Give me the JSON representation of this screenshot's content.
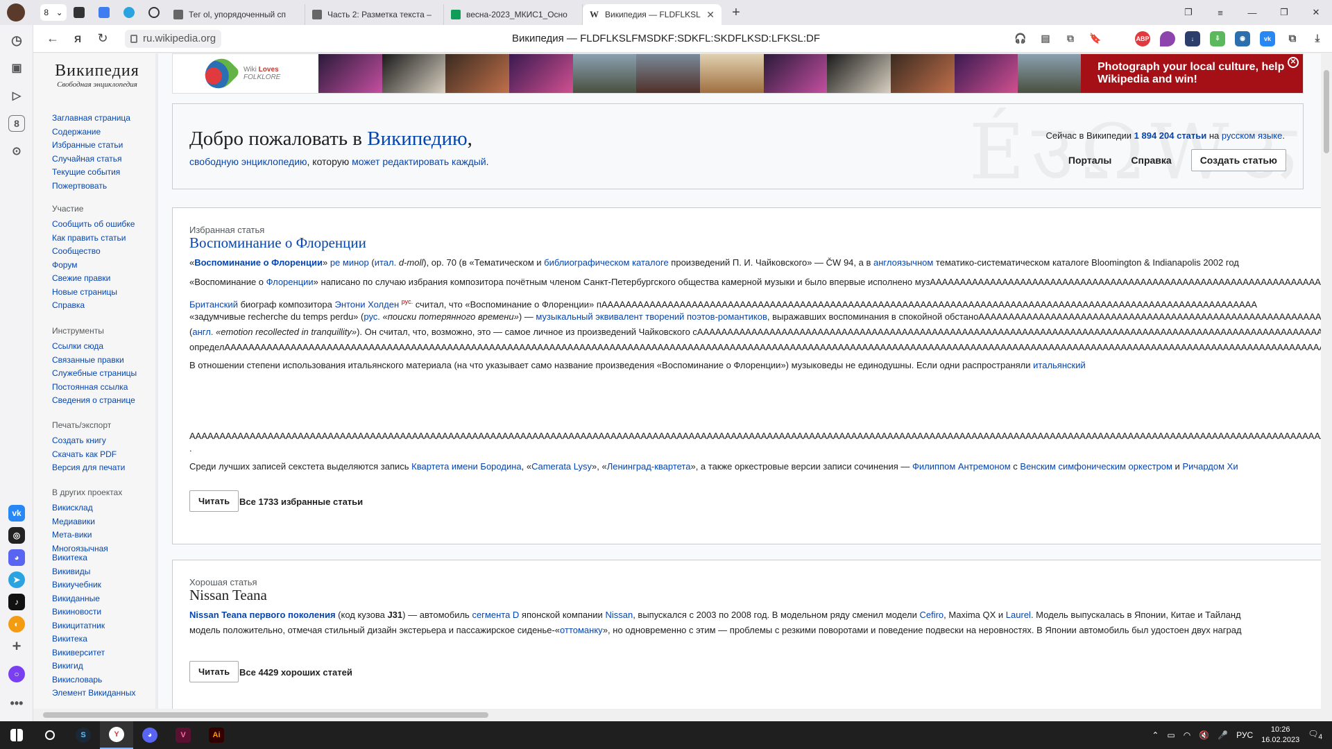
{
  "browser": {
    "tab_count": "8",
    "tabs": [
      {
        "label": "Тег ol, упорядоченный сп",
        "color": "#555"
      },
      {
        "label": "Часть 2: Разметка текста –",
        "color": "#555"
      },
      {
        "label": "весна-2023_МКИС1_Осно",
        "color": "#0f9d58"
      },
      {
        "label": "Википедия — FLDFLKSL",
        "color": "#222"
      }
    ],
    "url": "ru.wikipedia.org",
    "page_title": "Википедия — FLDFLKSLFMSDKF:SDKFL:SKDFLKSD:LFKSL:DF"
  },
  "wiki": {
    "logo_title": "Википедия",
    "logo_subtitle": "Свободная энциклопедия",
    "nav_main": [
      "Заглавная страница",
      "Содержание",
      "Избранные статьи",
      "Случайная статья",
      "Текущие события",
      "Пожертвовать"
    ],
    "nav_participation": {
      "heading": "Участие",
      "items": [
        "Сообщить об ошибке",
        "Как править статьи",
        "Сообщество",
        "Форум",
        "Свежие правки",
        "Новые страницы",
        "Справка"
      ]
    },
    "nav_tools": {
      "heading": "Инструменты",
      "items": [
        "Ссылки сюда",
        "Связанные правки",
        "Служебные страницы",
        "Постоянная ссылка",
        "Сведения о странице"
      ]
    },
    "nav_print": {
      "heading": "Печать/экспорт",
      "items": [
        "Создать книгу",
        "Скачать как PDF",
        "Версия для печати"
      ]
    },
    "nav_projects": {
      "heading": "В других проектах",
      "items": [
        "Викисклад",
        "Медиавики",
        "Мета-вики",
        "Многоязычная Викитека",
        "Викивиды",
        "Викиучебник",
        "Викиданные",
        "Викиновости",
        "Викицитатник",
        "Викитека",
        "Викиверситет",
        "Викигид",
        "Викисловарь",
        "Элемент Викиданных"
      ]
    }
  },
  "banner": {
    "wlf_line1": "Wiki",
    "wlf_bold": "Loves",
    "wlf_line2": "FOLKLORE",
    "cta": "Photograph your local culture, help Wikipedia and win!"
  },
  "welcome": {
    "title_prefix": "Добро пожаловать в ",
    "title_link": "Википедию",
    "title_suffix": ",",
    "sub_link1": "свободную энциклопедию",
    "sub_middle": ", которую ",
    "sub_link2": "может редактировать каждый",
    "sub_end": ".",
    "stats_prefix": "Сейчас в Википедии ",
    "stats_count": "1 894 204 статьи",
    "stats_mid": " на ",
    "stats_lang": "русском языке",
    "stats_end": ".",
    "portals": "Порталы",
    "help": "Справка",
    "create": "Создать статью"
  },
  "featured": {
    "label": "Избранная статья",
    "title": "Воспоминание о Флоренции",
    "read": "Читать",
    "all": "Все 1733 избранные статьи"
  },
  "good": {
    "label": "Хорошая статья",
    "title": "Nissan Teana",
    "read": "Читать",
    "all": "Все 4429 хороших статей"
  },
  "system": {
    "time": "10:26",
    "date": "16.02.2023",
    "lang": "РУС",
    "notifications": "4"
  }
}
